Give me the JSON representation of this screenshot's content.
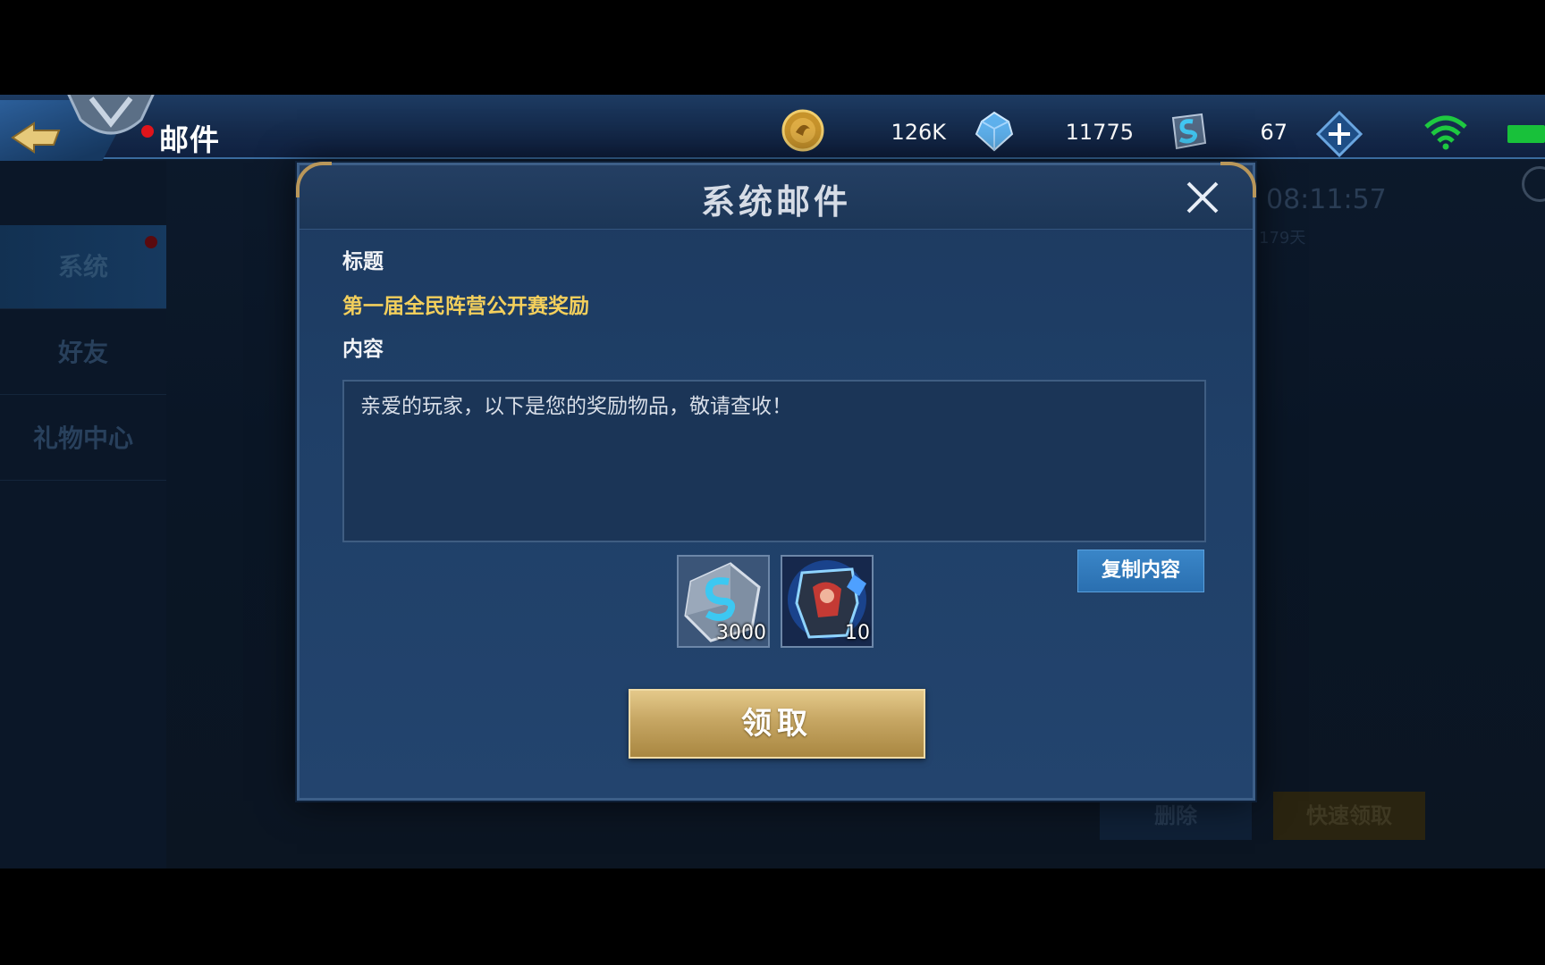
{
  "header": {
    "title": "邮件",
    "resources": [
      {
        "name": "gold",
        "icon": "gold-coin-icon",
        "value": "126K"
      },
      {
        "name": "diamond",
        "icon": "diamond-icon",
        "value": "11775"
      },
      {
        "name": "crystal",
        "icon": "rune-crystal-icon",
        "value": "67"
      }
    ]
  },
  "sidebar": {
    "items": [
      {
        "label": "系统",
        "active": true
      },
      {
        "label": "好友",
        "active": false
      },
      {
        "label": "礼物中心",
        "active": false
      }
    ]
  },
  "background": {
    "time": "08:11:57",
    "days": "179天",
    "delete_label": "删除",
    "quick_claim_label": "快速领取"
  },
  "dialog": {
    "title": "系统邮件",
    "subject_label": "标题",
    "subject": "第一届全民阵营公开赛奖励",
    "content_label": "内容",
    "content": "亲爱的玩家，以下是您的奖励物品，敬请查收！",
    "copy_label": "复制内容",
    "rewards": [
      {
        "name": "rune-crystal",
        "icon": "rune-crystal-icon",
        "quantity": "3000"
      },
      {
        "name": "skin-fragment",
        "icon": "skin-fragment-icon",
        "quantity": "10"
      }
    ],
    "claim_label": "领取"
  },
  "colors": {
    "accent_gold": "#f3cf5c",
    "button_blue": "#2a6fb0",
    "claim_gold": "#c6a663",
    "notification_red": "#e0141b"
  }
}
